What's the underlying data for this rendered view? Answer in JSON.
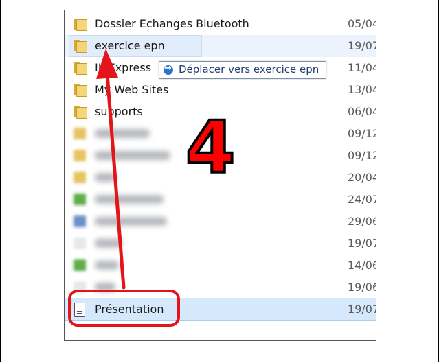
{
  "explorer": {
    "rows": [
      {
        "name": "Dossier Echanges Bluetooth",
        "date": "05/04",
        "type": "folder"
      },
      {
        "name": "exercice epn",
        "date": "19/07",
        "type": "folder",
        "state": "drop-target"
      },
      {
        "name": "IISExpress",
        "date": "11/04",
        "type": "folder"
      },
      {
        "name": "My Web Sites",
        "date": "13/04",
        "type": "folder"
      },
      {
        "name": "supports",
        "date": "06/04",
        "type": "folder"
      },
      {
        "name": "",
        "date": "09/12",
        "type": "blurred"
      },
      {
        "name": "",
        "date": "09/12",
        "type": "blurred"
      },
      {
        "name": "",
        "date": "20/04",
        "type": "blurred"
      },
      {
        "name": "",
        "date": "24/07",
        "type": "blurred"
      },
      {
        "name": "",
        "date": "29/06",
        "type": "blurred"
      },
      {
        "name": "",
        "date": "19/07",
        "type": "blurred"
      },
      {
        "name": "",
        "date": "14/06",
        "type": "blurred"
      },
      {
        "name": "",
        "date": "19/06",
        "type": "blurred"
      },
      {
        "name": "Présentation",
        "date": "19/07",
        "type": "document",
        "state": "selected"
      }
    ],
    "drag_tooltip": "Déplacer vers exercice epn",
    "step_number": "4"
  },
  "colors": {
    "annotation_red": "#e4141b",
    "selection_blue": "#d6e8fb",
    "folder_yellow": "#f3d57a"
  }
}
